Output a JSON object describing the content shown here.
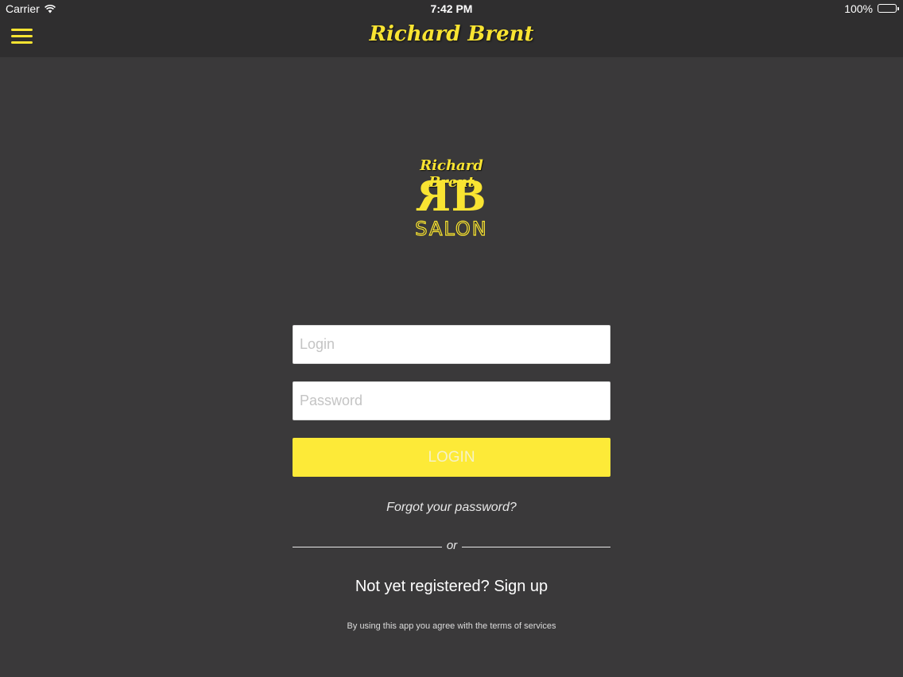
{
  "status_bar": {
    "carrier": "Carrier",
    "time": "7:42 PM",
    "battery": "100%"
  },
  "nav": {
    "title": "Richard Brent",
    "menu_icon": "hamburger-menu-icon"
  },
  "logo": {
    "script_text": "Richard Brent",
    "monogram_r": "R",
    "monogram_b": "B",
    "word": "SALON"
  },
  "form": {
    "login_placeholder": "Login",
    "password_placeholder": "Password",
    "login_button": "LOGIN",
    "forgot_password": "Forgot your password?",
    "divider_text": "or",
    "signup": "Not yet registered? Sign up",
    "terms": "By using this app you agree with the terms of services"
  },
  "colors": {
    "accent": "#f9e432",
    "button": "#fdea38",
    "background": "#3a393a",
    "bar": "#2f2e2f"
  }
}
